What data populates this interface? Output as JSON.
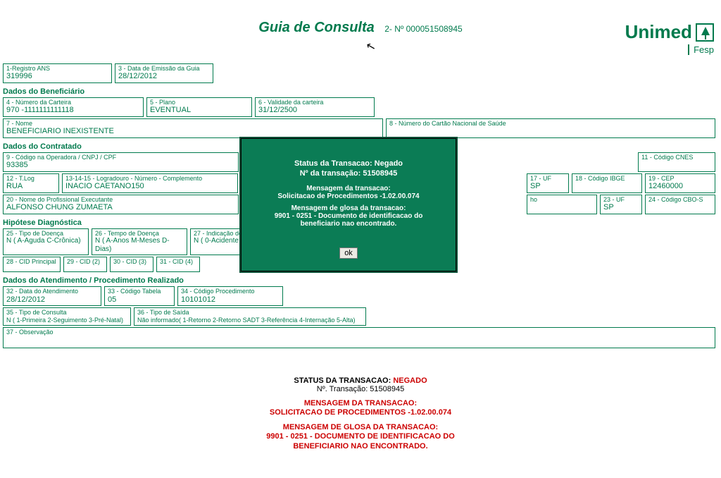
{
  "brand": {
    "name": "Unimed",
    "sub": "Fesp"
  },
  "page": {
    "title": "Guia de Consulta",
    "num_prefix": "2- Nº ",
    "num": "000051508945"
  },
  "top": {
    "f1_lbl": "1-Registro ANS",
    "f1_val": "319996",
    "f3_lbl": "3 - Data de Emissão da Guia",
    "f3_val": "28/12/2012"
  },
  "sec_benef": "Dados do Beneficiário",
  "benef": {
    "f4_lbl": "4 - Número da Carteira",
    "f4_val": "970 -1111111111118",
    "f5_lbl": "5 - Plano",
    "f5_val": "EVENTUAL",
    "f6_lbl": "6 - Validade da carteira",
    "f6_val": "31/12/2500",
    "f7_lbl": "7 - Nome",
    "f7_val": "BENEFICIARIO INEXISTENTE",
    "f8_lbl": "8 - Número do Cartão Nacional de Saúde",
    "f8_val": ""
  },
  "sec_contr": "Dados do Contratado",
  "contr": {
    "f9_lbl": "9 - Código na Operadora / CNPJ / CPF",
    "f9_val": "93385",
    "f11_lbl": "11 - Código CNES",
    "f11_val": "",
    "f12_lbl": "12 - T.Log",
    "f12_val": "RUA",
    "f13_lbl": "13-14-15 - Logradouro - Número - Complemento",
    "f13_val": "INACIO CAETANO150",
    "f17_lbl": "17 - UF",
    "f17_val": "SP",
    "f18_lbl": "18 - Código IBGE",
    "f18_val": "",
    "f19_lbl": "19 - CEP",
    "f19_val": "12460000",
    "f20_lbl": "20 - Nome do Profissional Executante",
    "f20_val": "ALFONSO CHUNG ZUMAETA",
    "f22_suffix": "ho",
    "f23_lbl": "23 - UF",
    "f23_val": "SP",
    "f24_lbl": "24 - Código CBO-S",
    "f24_val": ""
  },
  "sec_hip": "Hipótese Diagnóstica",
  "hip": {
    "f25_lbl": "25 - Tipo de Doença",
    "f25_val": "N ( A-Aguda C-Crônica)",
    "f26_lbl": "26 - Tempo de Doença",
    "f26_val": "N ( A-Anos M-Meses D-Dias)",
    "f27_lbl": "27 - Indicação do A",
    "f27_val": "N ( 0-Acidente ou",
    "f28_lbl": "28 - CID Principal",
    "f29_lbl": "29 - CID (2)",
    "f30_lbl": "30 - CID (3)",
    "f31_lbl": "31 - CID (4)"
  },
  "sec_atend": "Dados do Atendimento / Procedimento Realizado",
  "atend": {
    "f32_lbl": "32 - Data do Atendimento",
    "f32_val": "28/12/2012",
    "f33_lbl": "33 - Código Tabela",
    "f33_val": "05",
    "f34_lbl": "34 - Código Procedimento",
    "f34_val": "10101012",
    "f35_lbl": "35 - Tipo de Consulta",
    "f35_val": "N ( 1-Primeira 2-Seguimento 3-Pré-Natal)",
    "f36_lbl": "36 - Tipo de Saída",
    "f36_val": "Não informado( 1-Retorno 2-Retorno SADT 3-Referência 4-Internação 5-Alta)",
    "f37_lbl": "37 - Observação"
  },
  "footer": {
    "status_lbl": "STATUS DA TRANSACAO: ",
    "status_val": "NEGADO",
    "trans_no": "Nº. Transação: 51508945",
    "msg1_h": "MENSAGEM DA TRANSACAO:",
    "msg1_t": "SOLICITACAO DE PROCEDIMENTOS -1.02.00.074",
    "msg2_h": "MENSAGEM DE GLOSA DA TRANSACAO:",
    "msg2_t1": "9901 - 0251 - DOCUMENTO DE IDENTIFICACAO DO",
    "msg2_t2": "BENEFICIARIO NAO ENCONTRADO."
  },
  "modal": {
    "title": "Status da Transacao: Negado",
    "sub": "Nº da transação: 51508945",
    "m1_h": "Mensagem da transacao:",
    "m1_t": "Solicitacao de Procedimentos -1.02.00.074",
    "m2_h": "Mensagem de glosa da transacao:",
    "m2_t1": "9901 - 0251 - Documento de identificacao do",
    "m2_t2": "beneficiario nao encontrado.",
    "ok": "ok"
  }
}
